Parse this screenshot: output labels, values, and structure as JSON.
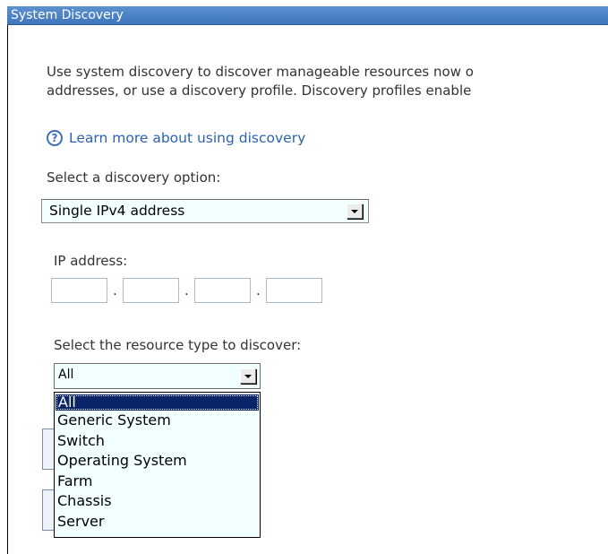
{
  "title": "System Discovery",
  "description": {
    "line1": "Use system discovery to discover manageable resources now o",
    "line2": "addresses, or use a discovery profile. Discovery profiles enable"
  },
  "help": {
    "link_text": "Learn more about using discovery",
    "icon": "help-question-icon"
  },
  "discovery_option": {
    "label": "Select a discovery option:",
    "selected": "Single IPv4 address"
  },
  "ip_address": {
    "label": "IP address:",
    "octets": [
      "",
      "",
      "",
      ""
    ],
    "separator": "."
  },
  "resource_type": {
    "label": "Select the resource type to discover:",
    "selected": "All",
    "options": [
      "All",
      "Generic System",
      "Switch",
      "Operating System",
      "Farm",
      "Chassis",
      "Server"
    ]
  },
  "colors": {
    "title_bar": "#4a80c4",
    "link": "#2a63b0",
    "selected_option": "#0a246a",
    "select_background": "#f2ffff"
  }
}
